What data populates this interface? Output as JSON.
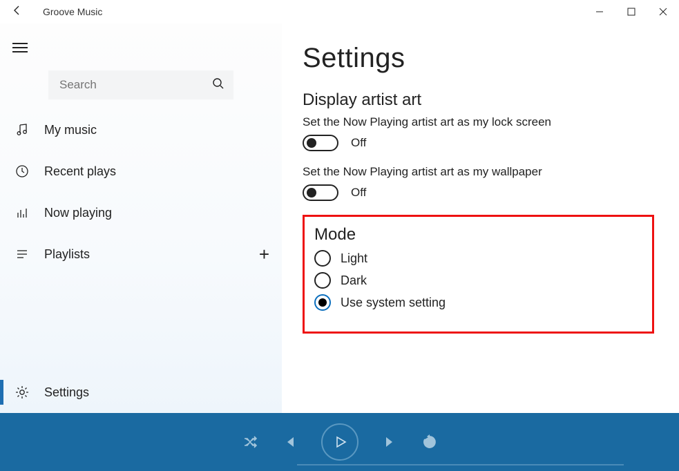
{
  "titlebar": {
    "app_name": "Groove Music"
  },
  "sidebar": {
    "search_placeholder": "Search",
    "items": [
      {
        "label": "My music"
      },
      {
        "label": "Recent plays"
      },
      {
        "label": "Now playing"
      },
      {
        "label": "Playlists"
      },
      {
        "label": "Settings"
      }
    ]
  },
  "main": {
    "page_title": "Settings",
    "artist_art": {
      "heading": "Display artist art",
      "lockscreen_desc": "Set the Now Playing artist art as my lock screen",
      "lockscreen_state": "Off",
      "wallpaper_desc": "Set the Now Playing artist art as my wallpaper",
      "wallpaper_state": "Off"
    },
    "mode": {
      "heading": "Mode",
      "options": [
        {
          "label": "Light"
        },
        {
          "label": "Dark"
        },
        {
          "label": "Use system setting"
        }
      ]
    }
  }
}
